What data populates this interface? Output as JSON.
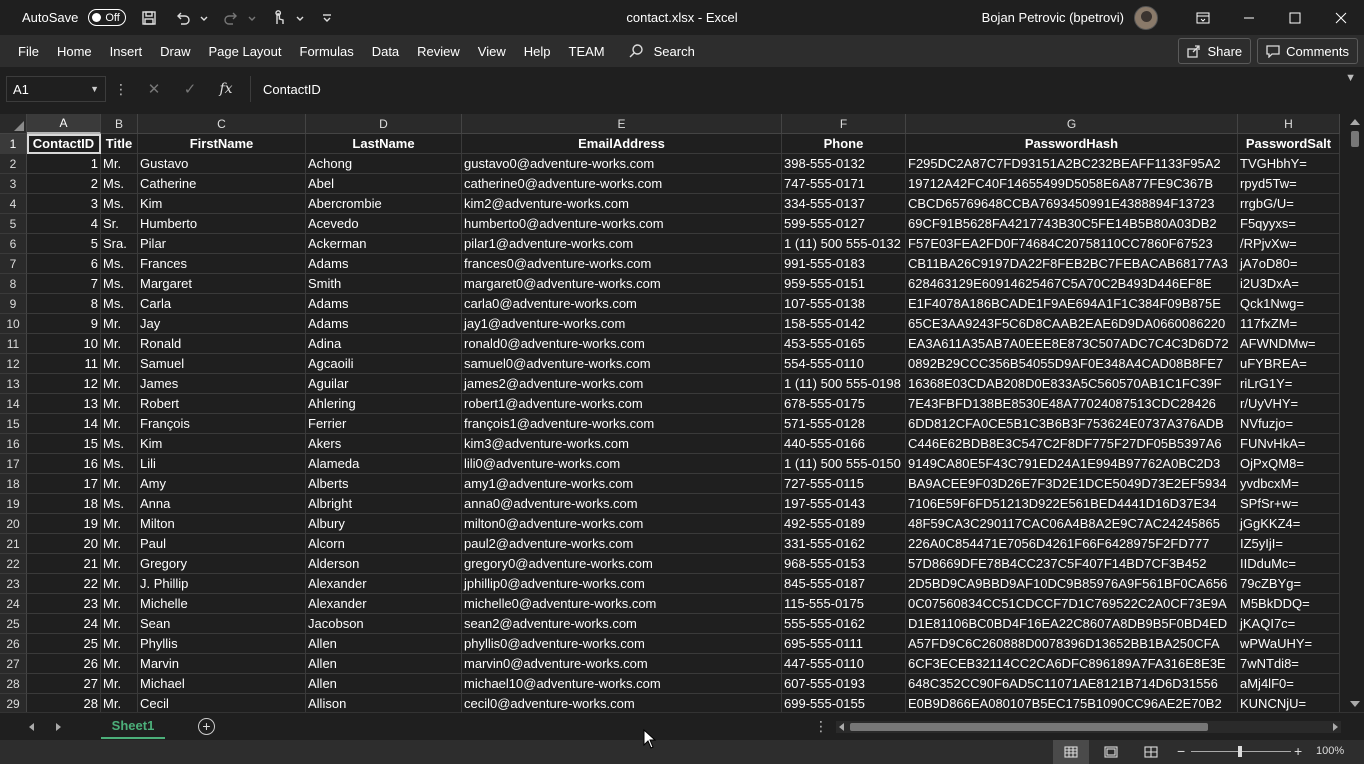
{
  "titlebar": {
    "autosave_label": "AutoSave",
    "autosave_state": "Off",
    "document_title": "contact.xlsx  -  Excel",
    "user_name": "Bojan Petrovic (bpetrovi)"
  },
  "ribbon": {
    "tabs": [
      "File",
      "Home",
      "Insert",
      "Draw",
      "Page Layout",
      "Formulas",
      "Data",
      "Review",
      "View",
      "Help",
      "TEAM"
    ],
    "search_label": "Search",
    "share_label": "Share",
    "comments_label": "Comments"
  },
  "formula_bar": {
    "name_box": "A1",
    "fx_label": "fx",
    "content": "ContactID"
  },
  "sheet": {
    "columns": [
      "A",
      "B",
      "C",
      "D",
      "E",
      "F",
      "G",
      "H"
    ],
    "headers": [
      "ContactID",
      "Title",
      "FirstName",
      "LastName",
      "EmailAddress",
      "Phone",
      "PasswordHash",
      "PasswordSalt"
    ],
    "rows": [
      [
        "1",
        "Mr.",
        "Gustavo",
        "Achong",
        "gustavo0@adventure-works.com",
        "398-555-0132",
        "F295DC2A87C7FD93151A2BC232BEAFF1133F95A2",
        "TVGHbhY="
      ],
      [
        "2",
        "Ms.",
        "Catherine",
        "Abel",
        "catherine0@adventure-works.com",
        "747-555-0171",
        "19712A42FC40F14655499D5058E6A877FE9C367B",
        "rpyd5Tw="
      ],
      [
        "3",
        "Ms.",
        "Kim",
        "Abercrombie",
        "kim2@adventure-works.com",
        "334-555-0137",
        "CBCD65769648CCBA7693450991E4388894F13723",
        "rrgbG/U="
      ],
      [
        "4",
        "Sr.",
        "Humberto",
        "Acevedo",
        "humberto0@adventure-works.com",
        "599-555-0127",
        "69CF91B5628FA4217743B30C5FE14B5B80A03DB2",
        "F5qyyxs="
      ],
      [
        "5",
        "Sra.",
        "Pilar",
        "Ackerman",
        "pilar1@adventure-works.com",
        "1 (11) 500 555-0132",
        "F57E03FEA2FD0F74684C20758110CC7860F67523",
        "/RPjvXw="
      ],
      [
        "6",
        "Ms.",
        "Frances",
        "Adams",
        "frances0@adventure-works.com",
        "991-555-0183",
        "CB11BA26C9197DA22F8FEB2BC7FEBACAB68177A3",
        "jA7oD80="
      ],
      [
        "7",
        "Ms.",
        "Margaret",
        "Smith",
        "margaret0@adventure-works.com",
        "959-555-0151",
        "628463129E60914625467C5A70C2B493D446EF8E",
        "i2U3DxA="
      ],
      [
        "8",
        "Ms.",
        "Carla",
        "Adams",
        "carla0@adventure-works.com",
        "107-555-0138",
        "E1F4078A186BCADE1F9AE694A1F1C384F09B875E",
        "Qck1Nwg="
      ],
      [
        "9",
        "Mr.",
        "Jay",
        "Adams",
        "jay1@adventure-works.com",
        "158-555-0142",
        "65CE3AA9243F5C6D8CAAB2EAE6D9DA0660086220",
        "117fxZM="
      ],
      [
        "10",
        "Mr.",
        "Ronald",
        "Adina",
        "ronald0@adventure-works.com",
        "453-555-0165",
        "EA3A611A35AB7A0EEE8E873C507ADC7C4C3D6D72",
        "AFWNDMw="
      ],
      [
        "11",
        "Mr.",
        "Samuel",
        "Agcaoili",
        "samuel0@adventure-works.com",
        "554-555-0110",
        "0892B29CCC356B54055D9AF0E348A4CAD08B8FE7",
        "uFYBREA="
      ],
      [
        "12",
        "Mr.",
        "James",
        "Aguilar",
        "james2@adventure-works.com",
        "1 (11) 500 555-0198",
        "16368E03CDAB208D0E833A5C560570AB1C1FC39F",
        "riLrG1Y="
      ],
      [
        "13",
        "Mr.",
        "Robert",
        "Ahlering",
        "robert1@adventure-works.com",
        "678-555-0175",
        "7E43FBFD138BE8530E48A77024087513CDC28426",
        "r/UyVHY="
      ],
      [
        "14",
        "Mr.",
        "François",
        "Ferrier",
        "françois1@adventure-works.com",
        "571-555-0128",
        "6DD812CFA0CE5B1C3B6B3F753624E0737A376ADB",
        "NVfuzjo="
      ],
      [
        "15",
        "Ms.",
        "Kim",
        "Akers",
        "kim3@adventure-works.com",
        "440-555-0166",
        "C446E62BDB8E3C547C2F8DF775F27DF05B5397A6",
        "FUNvHkA="
      ],
      [
        "16",
        "Ms.",
        "Lili",
        "Alameda",
        "lili0@adventure-works.com",
        "1 (11) 500 555-0150",
        "9149CA80E5F43C791ED24A1E994B97762A0BC2D3",
        "OjPxQM8="
      ],
      [
        "17",
        "Mr.",
        "Amy",
        "Alberts",
        "amy1@adventure-works.com",
        "727-555-0115",
        "BA9ACEE9F03D26E7F3D2E1DCE5049D73E2EF5934",
        "yvdbcxM="
      ],
      [
        "18",
        "Ms.",
        "Anna",
        "Albright",
        "anna0@adventure-works.com",
        "197-555-0143",
        "7106E59F6FD51213D922E561BED4441D16D37E34",
        "SPfSr+w="
      ],
      [
        "19",
        "Mr.",
        "Milton",
        "Albury",
        "milton0@adventure-works.com",
        "492-555-0189",
        "48F59CA3C290117CAC06A4B8A2E9C7AC24245865",
        "jGgKKZ4="
      ],
      [
        "20",
        "Mr.",
        "Paul",
        "Alcorn",
        "paul2@adventure-works.com",
        "331-555-0162",
        "226A0C854471E7056D4261F66F6428975F2FD777",
        "IZ5yIjI="
      ],
      [
        "21",
        "Mr.",
        "Gregory",
        "Alderson",
        "gregory0@adventure-works.com",
        "968-555-0153",
        "57D8669DFE78B4CC237C5F407F14BD7CF3B452",
        "IIDduMc="
      ],
      [
        "22",
        "Mr.",
        "J. Phillip",
        "Alexander",
        "jphillip0@adventure-works.com",
        "845-555-0187",
        "2D5BD9CA9BBD9AF10DC9B85976A9F561BF0CA656",
        "79cZBYg="
      ],
      [
        "23",
        "Mr.",
        "Michelle",
        "Alexander",
        "michelle0@adventure-works.com",
        "115-555-0175",
        "0C07560834CC51CDCCF7D1C769522C2A0CF73E9A",
        "M5BkDDQ="
      ],
      [
        "24",
        "Mr.",
        "Sean",
        "Jacobson",
        "sean2@adventure-works.com",
        "555-555-0162",
        "D1E81106BC0BD4F16EA22C8607A8DB9B5F0BD4ED",
        "jKAQI7c="
      ],
      [
        "25",
        "Mr.",
        "Phyllis",
        "Allen",
        "phyllis0@adventure-works.com",
        "695-555-0111",
        "A57FD9C6C260888D0078396D13652BB1BA250CFA",
        "wPWaUHY="
      ],
      [
        "26",
        "Mr.",
        "Marvin",
        "Allen",
        "marvin0@adventure-works.com",
        "447-555-0110",
        "6CF3ECEB32114CC2CA6DFC896189A7FA316E8E3E",
        "7wNTdi8="
      ],
      [
        "27",
        "Mr.",
        "Michael",
        "Allen",
        "michael10@adventure-works.com",
        "607-555-0193",
        "648C352CC90F6AD5C11071AE8121B714D6D31556",
        "aMj4lF0="
      ],
      [
        "28",
        "Mr.",
        "Cecil",
        "Allison",
        "cecil0@adventure-works.com",
        "699-555-0155",
        "E0B9D866EA080107B5EC175B1090CC96AE2E70B2",
        "KUNCNjU="
      ]
    ]
  },
  "sheet_tabs": {
    "active": "Sheet1"
  },
  "status_bar": {
    "zoom": "100%"
  },
  "icons": {
    "colors": {
      "accent": "#4caf7a",
      "background": "#1f1f1f",
      "ribbon": "#2d2d2d"
    }
  }
}
